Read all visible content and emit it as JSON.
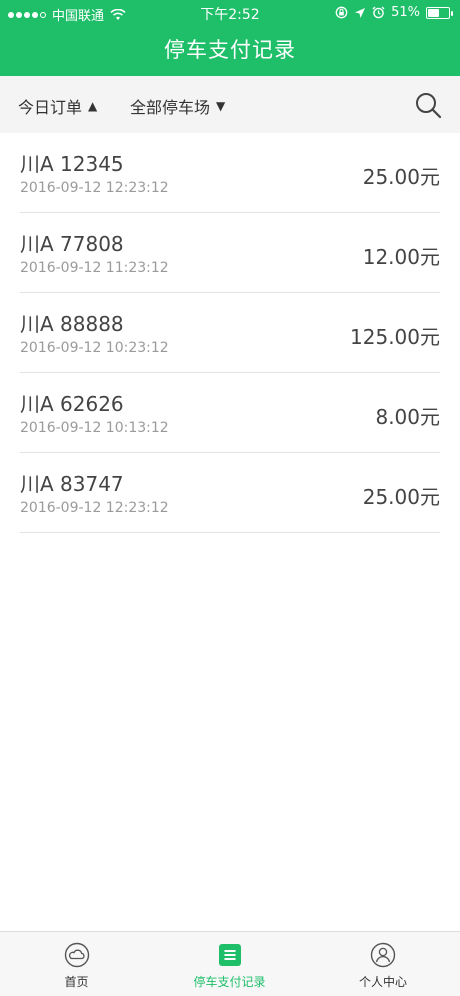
{
  "status_bar": {
    "carrier": "中国联通",
    "time": "下午2:52",
    "battery": "51%",
    "battery_level": 0.51
  },
  "header": {
    "title": "停车支付记录"
  },
  "filters": {
    "date_filter": "今日订单",
    "lot_filter": "全部停车场"
  },
  "records": [
    {
      "plate": "川A 12345",
      "time": "2016-09-12 12:23:12",
      "amount": "25.00元"
    },
    {
      "plate": "川A 77808",
      "time": "2016-09-12 11:23:12",
      "amount": "12.00元"
    },
    {
      "plate": "川A 88888",
      "time": "2016-09-12 10:23:12",
      "amount": "125.00元"
    },
    {
      "plate": "川A 62626",
      "time": "2016-09-12 10:13:12",
      "amount": "8.00元"
    },
    {
      "plate": "川A 83747",
      "time": "2016-09-12 12:23:12",
      "amount": "25.00元"
    }
  ],
  "tabbar": {
    "home": "首页",
    "records": "停车支付记录",
    "profile": "个人中心"
  },
  "colors": {
    "brand": "#1fbf6a"
  },
  "icons": {
    "search": "search-icon",
    "home": "cloud-home-icon",
    "records": "list-icon",
    "profile": "user-icon"
  }
}
